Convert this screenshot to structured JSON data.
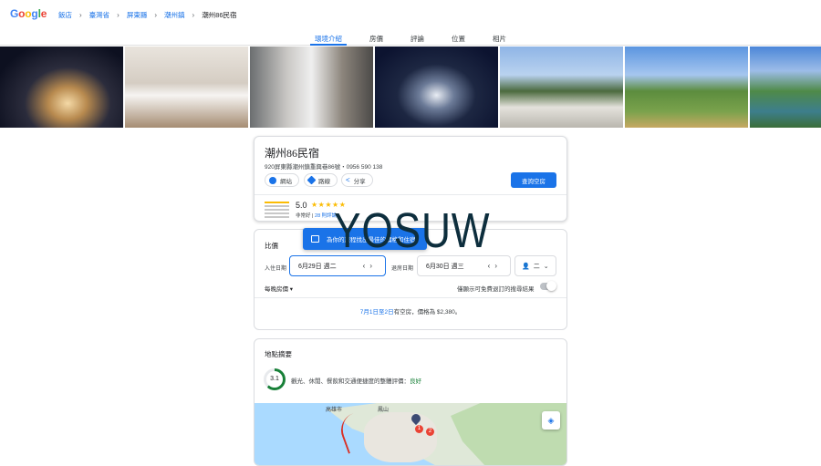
{
  "header": {
    "logo_letters": [
      {
        "ch": "G",
        "color": "#4285f4"
      },
      {
        "ch": "o",
        "color": "#ea4335"
      },
      {
        "ch": "o",
        "color": "#fbbc04"
      },
      {
        "ch": "g",
        "color": "#4285f4"
      },
      {
        "ch": "l",
        "color": "#34a853"
      },
      {
        "ch": "e",
        "color": "#ea4335"
      }
    ],
    "breadcrumbs": [
      "飯店",
      "臺灣省",
      "屏東縣",
      "潮州鎮",
      "潮州86民宿"
    ]
  },
  "tabs": [
    "環境介紹",
    "房價",
    "評論",
    "位置",
    "相片"
  ],
  "active_tab": "環境介紹",
  "hotel": {
    "name": "潮州86民宿",
    "address": "920屏東縣潮州鎮重興巷86號・0956 590 138",
    "website_label": "網站",
    "directions_label": "路線",
    "share_label": "分享",
    "check_availability_label": "查詢空房",
    "rating": "5.0",
    "stars": "★★★★★",
    "rating_word": "非常好",
    "reviews_link": "28 則評論"
  },
  "pricing": {
    "title": "比價",
    "banner_text": "為你的旅程找出最佳的價格和住宿",
    "checkin_label": "入住日期",
    "checkin_value": "6月29日 週二",
    "checkout_label": "退房日期",
    "checkout_value": "6月30日 週三",
    "guests_value": "二",
    "per_night_label": "每晚房價",
    "free_cancel_label": "僅顯示可免費退訂的搜尋結果",
    "availability_dates": "7月1日至2日",
    "availability_text": "有空房，價格為 $2,380。"
  },
  "location": {
    "title": "地點摘要",
    "score": "3.1",
    "score_fraction": 0.62,
    "description": "觀光、休閒、餐飲和交通便捷度的整體評價：",
    "rating_word": "良好",
    "map_labels": [
      "高雄市",
      "鳳山"
    ]
  },
  "watermark": "YOSUW"
}
